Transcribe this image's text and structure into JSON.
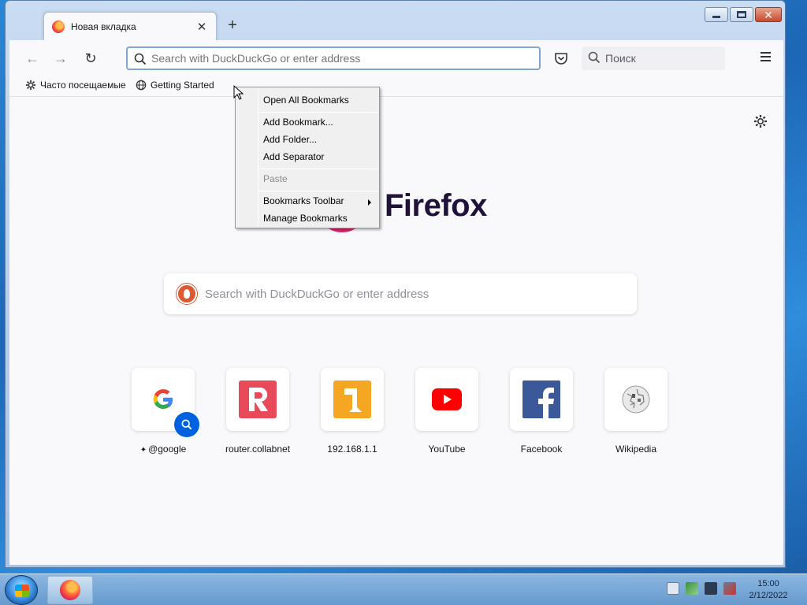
{
  "window": {
    "tab_title": "Новая вкладка",
    "tab_close": "✕",
    "new_tab": "+"
  },
  "navbar": {
    "back": "←",
    "forward": "→",
    "reload": "↻",
    "url_placeholder": "Search with DuckDuckGo or enter address",
    "search_placeholder": "Поиск"
  },
  "bookmarks_bar": {
    "items": [
      {
        "label": "Часто посещаемые",
        "icon": "gear-icon"
      },
      {
        "label": "Getting Started",
        "icon": "globe-icon"
      }
    ]
  },
  "context_menu": {
    "items": [
      {
        "label": "Open All Bookmarks",
        "disabled": false
      },
      {
        "label": "Add Bookmark...",
        "disabled": false
      },
      {
        "label": "Add Folder...",
        "disabled": false
      },
      {
        "label": "Add Separator",
        "disabled": false
      },
      {
        "label": "Paste",
        "disabled": true
      },
      {
        "label": "Bookmarks Toolbar",
        "disabled": false,
        "submenu": true
      },
      {
        "label": "Manage Bookmarks",
        "disabled": false
      }
    ]
  },
  "newtab": {
    "brand": "Firefox",
    "search_placeholder": "Search with DuckDuckGo or enter address",
    "tiles": [
      {
        "label": "@google",
        "pinned": true
      },
      {
        "label": "router.collabnet"
      },
      {
        "label": "192.168.1.1"
      },
      {
        "label": "YouTube"
      },
      {
        "label": "Facebook"
      },
      {
        "label": "Wikipedia"
      }
    ]
  },
  "taskbar": {
    "time": "15:00",
    "date": "2/12/2022"
  },
  "colors": {
    "accent": "#0061e0",
    "firefox_text": "#20123a"
  }
}
